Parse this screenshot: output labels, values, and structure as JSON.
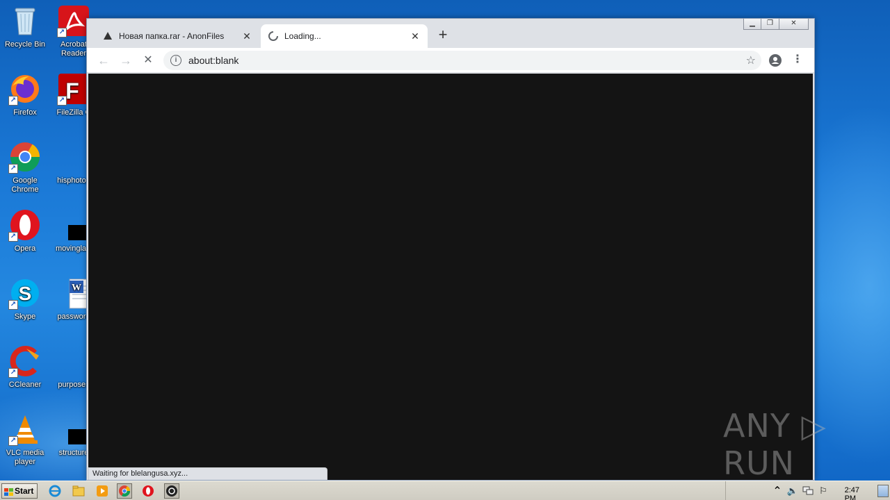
{
  "desktop": {
    "icons": [
      {
        "label": "Recycle Bin",
        "icon": "recycle-bin-icon"
      },
      {
        "label": "Acrobat Reader",
        "icon": "acrobat-reader-icon"
      },
      {
        "label": "Firefox",
        "icon": "firefox-icon"
      },
      {
        "label": "FileZilla C",
        "icon": "filezilla-icon"
      },
      {
        "label": "Google Chrome",
        "icon": "chrome-icon"
      },
      {
        "label": "hisphotog",
        "icon": "file-icon"
      },
      {
        "label": "Opera",
        "icon": "opera-icon"
      },
      {
        "label": "movinglaw",
        "icon": "file-icon"
      },
      {
        "label": "Skype",
        "icon": "skype-icon"
      },
      {
        "label": "password",
        "icon": "word-document-icon"
      },
      {
        "label": "CCleaner",
        "icon": "ccleaner-icon"
      },
      {
        "label": "purposes",
        "icon": "file-icon"
      },
      {
        "label": "VLC media player",
        "icon": "vlc-icon"
      },
      {
        "label": "structure",
        "icon": "file-icon"
      }
    ]
  },
  "browser": {
    "tabs": [
      {
        "title": "Новая папка.rar - AnonFiles",
        "active": false
      },
      {
        "title": "Loading...",
        "active": true
      }
    ],
    "new_tab_label": "+",
    "address": "about:blank",
    "status_text": "Waiting for blelangusa.xyz..."
  },
  "watermark": {
    "text": "ANY ▷ RUN"
  },
  "taskbar": {
    "start_label": "Start",
    "clock": "2:47 PM"
  },
  "colors": {
    "content_bg": "#141414",
    "tabstrip_bg": "#dee1e6",
    "wallpaper": "#1a78d6"
  }
}
